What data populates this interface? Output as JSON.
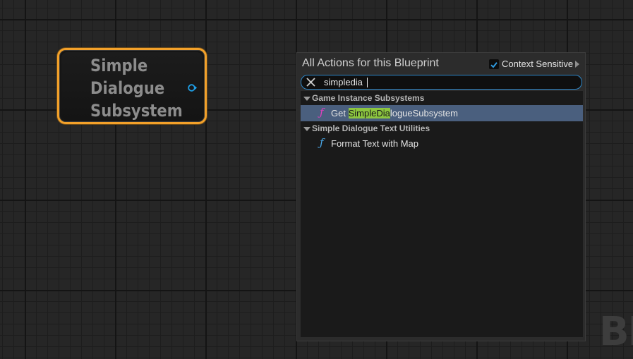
{
  "node": {
    "title_lines": [
      "Simple",
      "Dialogue",
      "Subsystem"
    ],
    "border_color": "#f3a12a",
    "pin_icon": "object-output-pin-icon",
    "pin_color": "#1fa0e8"
  },
  "action_menu": {
    "title": "All Actions for this Blueprint",
    "context_sensitive": {
      "label": "Context Sensitive",
      "checked": true
    },
    "search": {
      "value": "simpledia",
      "clear_icon": "close-icon"
    },
    "categories": [
      {
        "label": "Game Instance Subsystems",
        "actions": [
          {
            "icon": "function-icon",
            "icon_color": "#e040c0",
            "prefix": "Get ",
            "highlight": "SimpleDia",
            "suffix": "logueSubsystem",
            "selected": true
          }
        ]
      },
      {
        "label": "Simple Dialogue Text Utilities",
        "actions": [
          {
            "icon": "function-icon",
            "icon_color": "#4aa8e8",
            "label": "Format Text with Map",
            "selected": false
          }
        ]
      }
    ],
    "highlight_color": "#8cc63f",
    "selection_color": "#4a5f7e"
  },
  "watermark": {
    "text": "BL"
  }
}
